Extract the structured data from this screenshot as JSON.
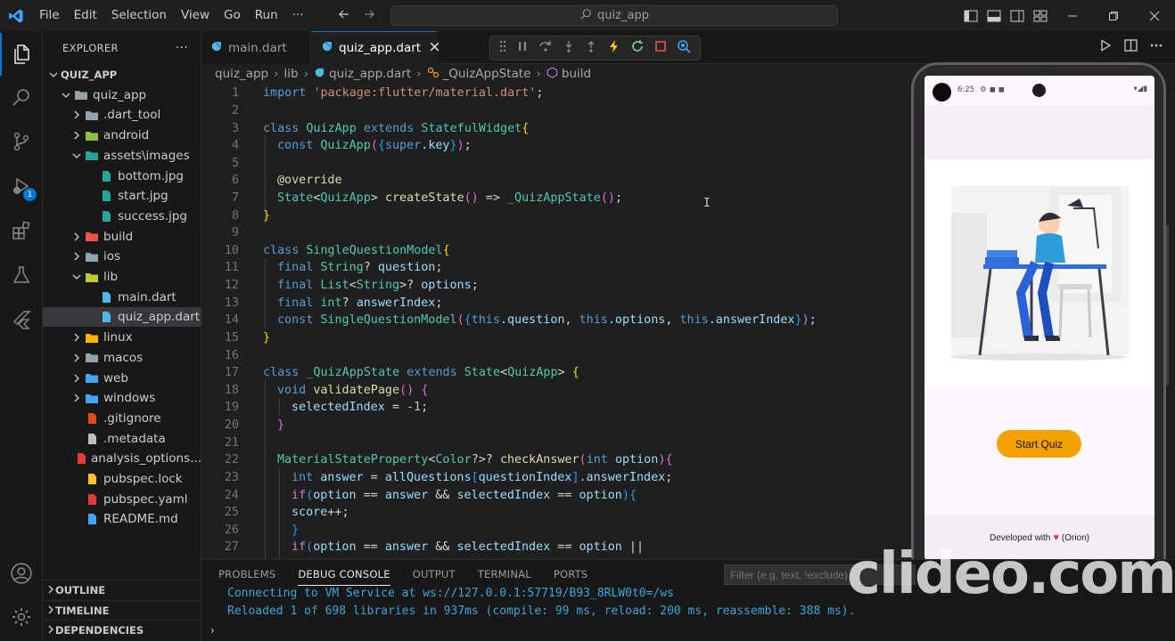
{
  "colors": {
    "accent": "#0078d4",
    "editor_bg": "#1f1f1f",
    "start_button": "#f5a100"
  },
  "menu": [
    "File",
    "Edit",
    "Selection",
    "View",
    "Go",
    "Run",
    "···"
  ],
  "search": {
    "text": "quiz_app"
  },
  "activity_badge": "1",
  "sidebar": {
    "title": "EXPLORER",
    "more": "···",
    "tree": [
      {
        "label": "QUIZ_APP",
        "kind": "root",
        "icon": "chevron-down"
      },
      {
        "label": "quiz_app",
        "kind": "folder-open",
        "icon": "folder-icon"
      },
      {
        "label": ".dart_tool",
        "kind": "folder",
        "icon": "folder-icon"
      },
      {
        "label": "android",
        "kind": "folder",
        "icon": "android-folder-icon"
      },
      {
        "label": "assets\\images",
        "kind": "folder-open",
        "icon": "images-folder-icon"
      },
      {
        "label": "bottom.jpg",
        "kind": "file",
        "icon": "image-file-icon"
      },
      {
        "label": "start.jpg",
        "kind": "file",
        "icon": "image-file-icon"
      },
      {
        "label": "success.jpg",
        "kind": "file",
        "icon": "image-file-icon"
      },
      {
        "label": "build",
        "kind": "folder",
        "icon": "build-folder-icon"
      },
      {
        "label": "ios",
        "kind": "folder",
        "icon": "ios-folder-icon"
      },
      {
        "label": "lib",
        "kind": "folder-open",
        "icon": "lib-folder-icon"
      },
      {
        "label": "main.dart",
        "kind": "file",
        "icon": "dart-file-icon"
      },
      {
        "label": "quiz_app.dart",
        "kind": "file",
        "icon": "dart-file-icon"
      },
      {
        "label": "linux",
        "kind": "folder",
        "icon": "linux-folder-icon"
      },
      {
        "label": "macos",
        "kind": "folder",
        "icon": "macos-folder-icon"
      },
      {
        "label": "web",
        "kind": "folder",
        "icon": "web-folder-icon"
      },
      {
        "label": "windows",
        "kind": "folder",
        "icon": "windows-folder-icon"
      },
      {
        "label": ".gitignore",
        "kind": "file",
        "icon": "git-file-icon"
      },
      {
        "label": ".metadata",
        "kind": "file",
        "icon": "file-icon"
      },
      {
        "label": "analysis_options...",
        "kind": "file",
        "icon": "yaml-file-icon"
      },
      {
        "label": "pubspec.lock",
        "kind": "file",
        "icon": "lock-file-icon"
      },
      {
        "label": "pubspec.yaml",
        "kind": "file",
        "icon": "yaml-file-icon"
      },
      {
        "label": "README.md",
        "kind": "file",
        "icon": "info-file-icon"
      }
    ],
    "sections": [
      "OUTLINE",
      "TIMELINE",
      "DEPENDENCIES"
    ]
  },
  "tabs": [
    {
      "label": "main.dart",
      "active": false
    },
    {
      "label": "quiz_app.dart",
      "active": true
    }
  ],
  "breadcrumb": [
    "quiz_app",
    "lib",
    "quiz_app.dart",
    "_QuizAppState",
    "build"
  ],
  "code_lines": [
    "1",
    "2",
    "3",
    "4",
    "5",
    "6",
    "7",
    "8",
    "9",
    "10",
    "11",
    "12",
    "13",
    "14",
    "15",
    "16",
    "17",
    "18",
    "19",
    "20",
    "21",
    "22",
    "23",
    "24",
    "25",
    "26",
    "27"
  ],
  "code_text": {
    "l1_kw": "import ",
    "l1_str": "'package:flutter/material.dart'",
    "l1_end": ";",
    "l3_kw1": "class ",
    "l3_ty1": "QuizApp",
    "l3_kw2": " extends ",
    "l3_ty2": "StatefulWidget",
    "l3_br": "{",
    "l4_kw": "const ",
    "l4_ty": "QuizApp",
    "l4_p1": "(",
    "l4_b1": "{",
    "l4_kw2": "super",
    "l4_dot": ".",
    "l4_var": "key",
    "l4_b2": "}",
    "l4_p2": ")",
    "l4_end": ";",
    "l6_ann": "@override",
    "l7_ty1": "State",
    "l7_lt": "<",
    "l7_ty2": "QuizApp",
    "l7_gt": "> ",
    "l7_fn": "createState",
    "l7_p": "()",
    "l7_arrow": " => ",
    "l7_fn2": "_QuizAppState",
    "l7_p2": "()",
    "l7_end": ";",
    "l8_br": "}",
    "l10_kw": "class ",
    "l10_ty": "SingleQuestionModel",
    "l10_br": "{",
    "l11_kw": "final ",
    "l11_ty": "String",
    "l11_q": "? ",
    "l11_var": "question",
    "l11_end": ";",
    "l12_kw": "final ",
    "l12_ty": "List",
    "l12_lt": "<",
    "l12_ty2": "String",
    "l12_gt": ">? ",
    "l12_var": "options",
    "l12_end": ";",
    "l13_kw": "final ",
    "l13_ty": "int",
    "l13_q": "? ",
    "l13_var": "answerIndex",
    "l13_end": ";",
    "l14_kw": "const ",
    "l14_ty": "SingleQuestionModel",
    "l14_p1": "(",
    "l14_b1": "{",
    "l14_t1": "this",
    "l14_v1": ".question",
    "l14_c1": ", ",
    "l14_t2": "this",
    "l14_v2": ".options",
    "l14_c2": ", ",
    "l14_t3": "this",
    "l14_v3": ".answerIndex",
    "l14_b2": "}",
    "l14_p2": ")",
    "l14_end": ";",
    "l15_br": "}",
    "l17_kw": "class ",
    "l17_ty": "_QuizAppState",
    "l17_kw2": " extends ",
    "l17_ty2": "State",
    "l17_lt": "<",
    "l17_ty3": "QuizApp",
    "l17_gt": "> ",
    "l17_br": "{",
    "l18_kw": "void ",
    "l18_fn": "validatePage",
    "l18_p": "() ",
    "l18_br": "{",
    "l19_var": "selectedIndex",
    "l19_eq": " = ",
    "l19_num": "-1",
    "l19_end": ";",
    "l20_br": "}",
    "l22_ty": "MaterialStateProperty",
    "l22_lt": "<",
    "l22_ty2": "Color",
    "l22_gt": "?>? ",
    "l22_fn": "checkAnswer",
    "l22_p1": "(",
    "l22_kw": "int ",
    "l22_var": "option",
    "l22_p2": ")",
    "l22_br": "{",
    "l23_kw": "int ",
    "l23_var": "answer",
    "l23_eq": " = ",
    "l23_var2": "allQuestions",
    "l23_b1": "[",
    "l23_var3": "questionIndex",
    "l23_b2": "]",
    "l23_var4": ".answerIndex",
    "l23_end": ";",
    "l24_ctl": "if",
    "l24_p1": "(",
    "l24_var": "option",
    "l24_op": " == ",
    "l24_var2": "answer",
    "l24_op2": " && ",
    "l24_var3": "selectedIndex",
    "l24_op3": " == ",
    "l24_var4": "option",
    "l24_p2": ")",
    "l24_br": "{",
    "l25_var": "score",
    "l25_op": "++",
    "l25_end": ";",
    "l26_br": "}",
    "l27_ctl": "if",
    "l27_p1": "(",
    "l27_var": "option",
    "l27_op": " == ",
    "l27_var2": "answer",
    "l27_op2": " && ",
    "l27_var3": "selectedIndex",
    "l27_op3": " == ",
    "l27_var4": "option",
    "l27_op4": " ||"
  },
  "emulator": {
    "time": "6:25",
    "start_button": "Start Quiz",
    "footer_text": "Developed with",
    "footer_suffix": "(Orion)"
  },
  "panel": {
    "tabs": [
      "PROBLEMS",
      "DEBUG CONSOLE",
      "OUTPUT",
      "TERMINAL",
      "PORTS"
    ],
    "active_tab": "DEBUG CONSOLE",
    "filter_placeholder": "Filter (e.g. text, !exclude)",
    "console": [
      "Connecting to VM Service at ws://127.0.0.1:57719/B93_8RLW0t0=/ws",
      "Reloaded 1 of 698 libraries in 937ms (compile: 99 ms, reload: 200 ms, reassemble: 388 ms)."
    ]
  },
  "watermark": "clideo.com"
}
